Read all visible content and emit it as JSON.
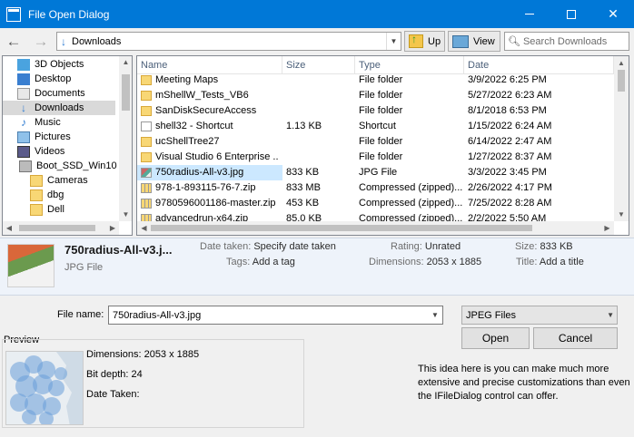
{
  "window": {
    "title": "File Open Dialog"
  },
  "nav": {
    "back": "←",
    "forward": "→"
  },
  "address": {
    "path": "Downloads"
  },
  "toolbar": {
    "up_label": "Up",
    "view_label": "View"
  },
  "search": {
    "placeholder": "Search Downloads"
  },
  "tree": {
    "items": [
      {
        "label": "3D Objects",
        "icon": "3d-objects-icon"
      },
      {
        "label": "Desktop",
        "icon": "desktop-icon"
      },
      {
        "label": "Documents",
        "icon": "documents-icon"
      },
      {
        "label": "Downloads",
        "icon": "downloads-icon",
        "selected": true
      },
      {
        "label": "Music",
        "icon": "music-icon"
      },
      {
        "label": "Pictures",
        "icon": "pictures-icon"
      },
      {
        "label": "Videos",
        "icon": "videos-icon"
      },
      {
        "label": "Boot_SSD_Win10",
        "icon": "drive-icon"
      },
      {
        "label": "Cameras",
        "icon": "folder-icon"
      },
      {
        "label": "dbg",
        "icon": "folder-icon"
      },
      {
        "label": "Dell",
        "icon": "folder-icon"
      }
    ]
  },
  "files": {
    "columns": {
      "name": "Name",
      "size": "Size",
      "type": "Type",
      "date": "Date"
    },
    "rows": [
      {
        "name": "Meeting Maps",
        "size": "",
        "type": "File folder",
        "date": "3/9/2022 6:25 PM",
        "icon": "folder"
      },
      {
        "name": "mShellW_Tests_VB6",
        "size": "",
        "type": "File folder",
        "date": "5/27/2022 6:23 AM",
        "icon": "folder"
      },
      {
        "name": "SanDiskSecureAccess",
        "size": "",
        "type": "File folder",
        "date": "8/1/2018 6:53 PM",
        "icon": "folder"
      },
      {
        "name": "shell32 - Shortcut",
        "size": "1.13 KB",
        "type": "Shortcut",
        "date": "1/15/2022 6:24 AM",
        "icon": "shortcut"
      },
      {
        "name": "ucShellTree27",
        "size": "",
        "type": "File folder",
        "date": "6/14/2022 2:47 AM",
        "icon": "folder"
      },
      {
        "name": "Visual Studio 6 Enterprise ...",
        "size": "",
        "type": "File folder",
        "date": "1/27/2022 8:37 AM",
        "icon": "folder"
      },
      {
        "name": "750radius-All-v3.jpg",
        "size": "833 KB",
        "type": "JPG File",
        "date": "3/3/2022 3:45 PM",
        "icon": "jpg",
        "selected": true
      },
      {
        "name": "978-1-893115-76-7.zip",
        "size": "833 MB",
        "type": "Compressed (zipped)...",
        "date": "2/26/2022 4:17 PM",
        "icon": "zip"
      },
      {
        "name": "9780596001186-master.zip",
        "size": "453 KB",
        "type": "Compressed (zipped)...",
        "date": "7/25/2022 8:28 AM",
        "icon": "zip"
      },
      {
        "name": "advancedrun-x64.zip",
        "size": "85.0 KB",
        "type": "Compressed (zipped)...",
        "date": "2/2/2022 5:50 AM",
        "icon": "zip"
      }
    ]
  },
  "details": {
    "name": "750radius-All-v3.j...",
    "type": "JPG File",
    "date_taken_label": "Date taken:",
    "date_taken_value": "Specify date taken",
    "tags_label": "Tags:",
    "tags_value": "Add a tag",
    "rating_label": "Rating:",
    "rating_value": "Unrated",
    "dimensions_label": "Dimensions:",
    "dimensions_value": "2053 x 1885",
    "size_label": "Size:",
    "size_value": "833 KB",
    "title_label": "Title:",
    "title_value": "Add a title"
  },
  "bottom": {
    "filename_label": "File name:",
    "filename_value": "750radius-All-v3.jpg",
    "filter_value": "JPEG Files",
    "open_label": "Open",
    "cancel_label": "Cancel"
  },
  "preview": {
    "label": "Preview",
    "dimensions": "Dimensions: 2053 x 1885",
    "bit_depth": "Bit depth: 24",
    "date_taken": "Date Taken:"
  },
  "promo": {
    "text": "This idea here is you can make much more extensive and precise customizations than even the IFileDialog control can offer."
  },
  "colors": {
    "titlebar": "#0078d7",
    "selection": "#cce8ff"
  }
}
